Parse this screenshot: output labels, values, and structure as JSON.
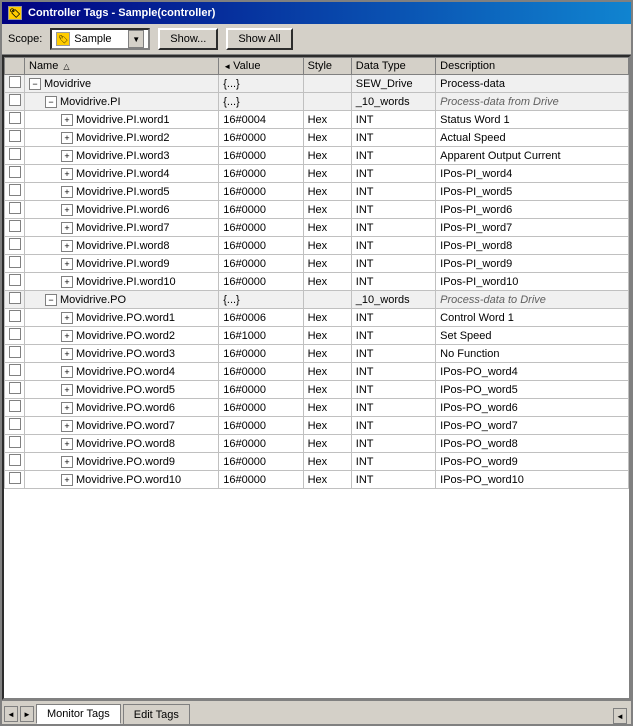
{
  "window": {
    "title": "Controller Tags - Sample(controller)",
    "icon": "tag-icon"
  },
  "toolbar": {
    "scope_label": "Scope:",
    "scope_value": "Sample",
    "show_button": "Show...",
    "show_all_button": "Show All"
  },
  "table": {
    "headers": [
      {
        "id": "checkbox",
        "label": ""
      },
      {
        "id": "name",
        "label": "Name",
        "sort": "asc"
      },
      {
        "id": "value",
        "label": "Value",
        "sort": "left"
      },
      {
        "id": "style",
        "label": "Style"
      },
      {
        "id": "datatype",
        "label": "Data Type"
      },
      {
        "id": "description",
        "label": "Description"
      }
    ],
    "rows": [
      {
        "indent": 1,
        "expand": "minus",
        "name": "Movidrive",
        "value": "{...}",
        "style": "",
        "datatype": "SEW_Drive",
        "description": "Process-data",
        "group": true
      },
      {
        "indent": 2,
        "expand": "minus",
        "name": "Movidrive.PI",
        "value": "{...}",
        "style": "",
        "datatype": "_10_words",
        "description": "Process-data from Drive",
        "group": true,
        "italic_desc": true
      },
      {
        "indent": 3,
        "expand": "plus",
        "name": "Movidrive.PI.word1",
        "value": "16#0004",
        "style": "Hex",
        "datatype": "INT",
        "description": "Status Word 1"
      },
      {
        "indent": 3,
        "expand": "plus",
        "name": "Movidrive.PI.word2",
        "value": "16#0000",
        "style": "Hex",
        "datatype": "INT",
        "description": "Actual Speed"
      },
      {
        "indent": 3,
        "expand": "plus",
        "name": "Movidrive.PI.word3",
        "value": "16#0000",
        "style": "Hex",
        "datatype": "INT",
        "description": "Apparent Output Current"
      },
      {
        "indent": 3,
        "expand": "plus",
        "name": "Movidrive.PI.word4",
        "value": "16#0000",
        "style": "Hex",
        "datatype": "INT",
        "description": "IPos-PI_word4"
      },
      {
        "indent": 3,
        "expand": "plus",
        "name": "Movidrive.PI.word5",
        "value": "16#0000",
        "style": "Hex",
        "datatype": "INT",
        "description": "IPos-PI_word5"
      },
      {
        "indent": 3,
        "expand": "plus",
        "name": "Movidrive.PI.word6",
        "value": "16#0000",
        "style": "Hex",
        "datatype": "INT",
        "description": "IPos-PI_word6"
      },
      {
        "indent": 3,
        "expand": "plus",
        "name": "Movidrive.PI.word7",
        "value": "16#0000",
        "style": "Hex",
        "datatype": "INT",
        "description": "IPos-PI_word7"
      },
      {
        "indent": 3,
        "expand": "plus",
        "name": "Movidrive.PI.word8",
        "value": "16#0000",
        "style": "Hex",
        "datatype": "INT",
        "description": "IPos-PI_word8"
      },
      {
        "indent": 3,
        "expand": "plus",
        "name": "Movidrive.PI.word9",
        "value": "16#0000",
        "style": "Hex",
        "datatype": "INT",
        "description": "IPos-PI_word9"
      },
      {
        "indent": 3,
        "expand": "plus",
        "name": "Movidrive.PI.word10",
        "value": "16#0000",
        "style": "Hex",
        "datatype": "INT",
        "description": "IPos-PI_word10"
      },
      {
        "indent": 2,
        "expand": "minus",
        "name": "Movidrive.PO",
        "value": "{...}",
        "style": "",
        "datatype": "_10_words",
        "description": "Process-data to Drive",
        "group": true,
        "italic_desc": true
      },
      {
        "indent": 3,
        "expand": "plus",
        "name": "Movidrive.PO.word1",
        "value": "16#0006",
        "style": "Hex",
        "datatype": "INT",
        "description": "Control Word 1"
      },
      {
        "indent": 3,
        "expand": "plus",
        "name": "Movidrive.PO.word2",
        "value": "16#1000",
        "style": "Hex",
        "datatype": "INT",
        "description": "Set Speed"
      },
      {
        "indent": 3,
        "expand": "plus",
        "name": "Movidrive.PO.word3",
        "value": "16#0000",
        "style": "Hex",
        "datatype": "INT",
        "description": "No Function"
      },
      {
        "indent": 3,
        "expand": "plus",
        "name": "Movidrive.PO.word4",
        "value": "16#0000",
        "style": "Hex",
        "datatype": "INT",
        "description": "IPos-PO_word4"
      },
      {
        "indent": 3,
        "expand": "plus",
        "name": "Movidrive.PO.word5",
        "value": "16#0000",
        "style": "Hex",
        "datatype": "INT",
        "description": "IPos-PO_word5"
      },
      {
        "indent": 3,
        "expand": "plus",
        "name": "Movidrive.PO.word6",
        "value": "16#0000",
        "style": "Hex",
        "datatype": "INT",
        "description": "IPos-PO_word6"
      },
      {
        "indent": 3,
        "expand": "plus",
        "name": "Movidrive.PO.word7",
        "value": "16#0000",
        "style": "Hex",
        "datatype": "INT",
        "description": "IPos-PO_word7"
      },
      {
        "indent": 3,
        "expand": "plus",
        "name": "Movidrive.PO.word8",
        "value": "16#0000",
        "style": "Hex",
        "datatype": "INT",
        "description": "IPos-PO_word8"
      },
      {
        "indent": 3,
        "expand": "plus",
        "name": "Movidrive.PO.word9",
        "value": "16#0000",
        "style": "Hex",
        "datatype": "INT",
        "description": "IPos-PO_word9"
      },
      {
        "indent": 3,
        "expand": "plus",
        "name": "Movidrive.PO.word10",
        "value": "16#0000",
        "style": "Hex",
        "datatype": "INT",
        "description": "IPos-PO_word10"
      }
    ]
  },
  "tabs": [
    {
      "id": "monitor",
      "label": "Monitor Tags",
      "active": true
    },
    {
      "id": "edit",
      "label": "Edit Tags",
      "active": false
    }
  ]
}
